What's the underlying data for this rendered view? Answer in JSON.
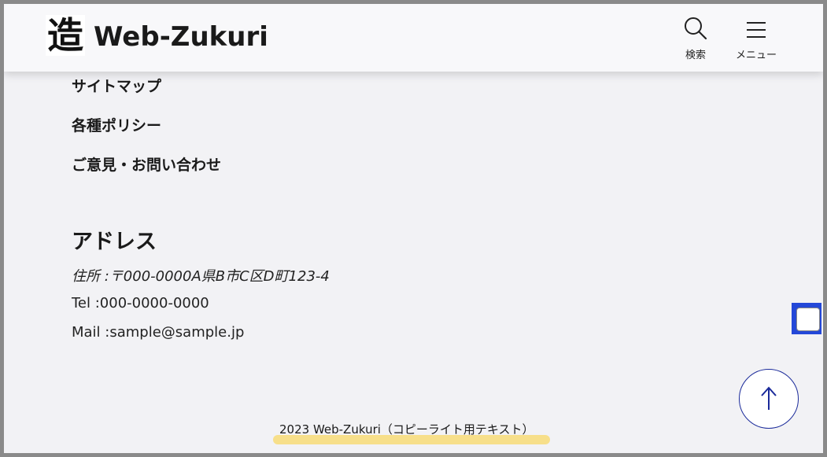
{
  "header": {
    "logo_mark": "造",
    "site_name": "Web-Zukuri",
    "search_label": "検索",
    "menu_label": "メニュー"
  },
  "nav": {
    "items": [
      {
        "label": "サイトマップ"
      },
      {
        "label": "各種ポリシー"
      },
      {
        "label": "ご意見・お問い合わせ"
      }
    ]
  },
  "address": {
    "title": "アドレス",
    "location": "住所 :〒000-0000A県B市C区D町123-4",
    "tel": "Tel :000-0000-0000",
    "mail": "Mail :sample@sample.jp"
  },
  "footer": {
    "copyright": "2023 Web-Zukuri（コピーライト用テキスト）"
  },
  "colors": {
    "accent_blue": "#1a2a9a",
    "highlight_yellow": "#f7df8a",
    "focus_blue": "#2448d8"
  },
  "icons": [
    "search-icon",
    "hamburger-menu-icon",
    "arrow-up-icon"
  ]
}
